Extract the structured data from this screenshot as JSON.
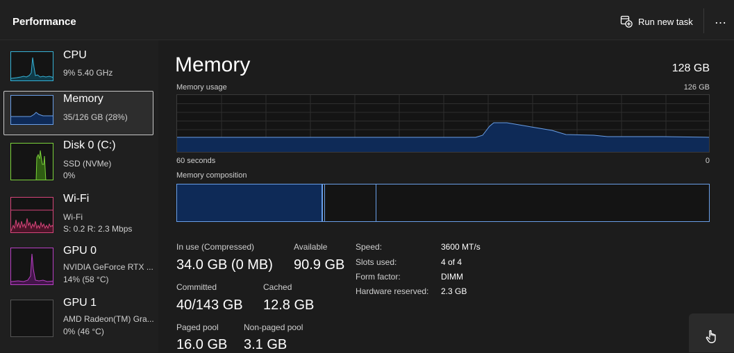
{
  "header": {
    "title": "Performance",
    "run_task_label": "Run new task",
    "more_label": "…"
  },
  "sidebar": {
    "items": [
      {
        "title": "CPU",
        "lines": [
          "9%  5.40 GHz"
        ],
        "color": "#36b2d6"
      },
      {
        "title": "Memory",
        "lines": [
          "35/126 GB (28%)"
        ],
        "color": "#6a9fe8",
        "selected": true
      },
      {
        "title": "Disk 0 (C:)",
        "lines": [
          "SSD (NVMe)",
          "0%"
        ],
        "color": "#7bd33a"
      },
      {
        "title": "Wi-Fi",
        "lines": [
          "Wi-Fi",
          "S: 0.2  R: 2.3 Mbps"
        ],
        "color": "#d6457a"
      },
      {
        "title": "GPU 0",
        "lines": [
          "NVIDIA GeForce RTX ...",
          "14%  (58 °C)"
        ],
        "color": "#b83fc4"
      },
      {
        "title": "GPU 1",
        "lines": [
          "AMD Radeon(TM) Gra...",
          "0%  (46 °C)"
        ],
        "color": "#b83fc4"
      }
    ]
  },
  "main": {
    "heading": "Memory",
    "total": "128 GB",
    "usage_label": "Memory usage",
    "usage_max": "126 GB",
    "time_label": "60 seconds",
    "time_zero": "0",
    "composition_label": "Memory composition",
    "stats": {
      "in_use_label": "In use (Compressed)",
      "in_use_value": "34.0 GB (0 MB)",
      "available_label": "Available",
      "available_value": "90.9 GB",
      "committed_label": "Committed",
      "committed_value": "40/143 GB",
      "cached_label": "Cached",
      "cached_value": "12.8 GB",
      "paged_label": "Paged pool",
      "paged_value": "16.0 GB",
      "nonpaged_label": "Non-paged pool",
      "nonpaged_value": "3.1 GB"
    },
    "specs": [
      {
        "label": "Speed:",
        "value": "3600 MT/s"
      },
      {
        "label": "Slots used:",
        "value": "4 of 4"
      },
      {
        "label": "Form factor:",
        "value": "DIMM"
      },
      {
        "label": "Hardware reserved:",
        "value": "2.3 GB"
      }
    ]
  },
  "colors": {
    "accent": "#6a9fe8",
    "memory_fill": "#0e2a57",
    "background": "#1c1c1c"
  }
}
